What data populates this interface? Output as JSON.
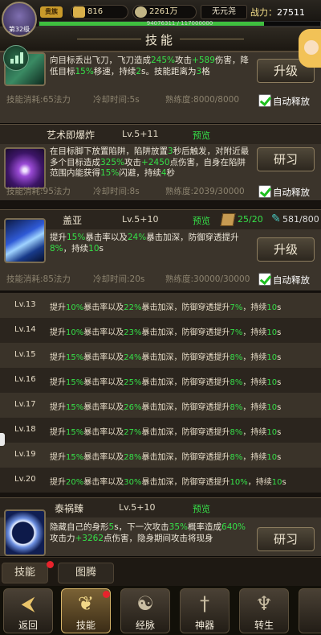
{
  "header": {
    "player_level_label": "第32级",
    "vip_label": "贵族",
    "gold": "816",
    "silver": "2261万",
    "realm": "无元尧",
    "power_label": "战力：",
    "power_value": "27511",
    "exp_text": "94076311 / 117000000",
    "exp_fraction": 0.8
  },
  "page_title": "技能",
  "skills": [
    {
      "id": "flying-knife",
      "desc": "向目标丢出飞刀，飞刀造成245%攻击+589伤害，降低目标15%移速，持续2s。技能距离为3格",
      "cost": "技能消耗:65法力",
      "cooldown": "冷却时间:5s",
      "mastery": "熟练度:8000/8000",
      "button": "升级",
      "auto_label": "自动释放"
    },
    {
      "id": "art-explosion",
      "name": "艺术即爆炸",
      "level": "Lv.5+11",
      "preview": "预览",
      "desc": "在目标脚下放置陷阱，陷阱放置3秒后触发，对附近最多个目标造成325%攻击+2450点伤害，自身在陷阱范围内能获得15%闪避，持续4秒",
      "cost": "技能消耗:95法力",
      "cooldown": "冷却时间:8s",
      "mastery": "熟练度:2039/30000",
      "button": "研习",
      "auto_label": "自动释放"
    },
    {
      "id": "gaia",
      "name": "盖亚",
      "level": "Lv.5+10",
      "preview": "预览",
      "book_count": "25/20",
      "scroll_count": "581/800",
      "desc": "提升15%暴击率以及24%暴击加深，防御穿透提升8%，持续10s",
      "cost": "技能消耗:85法力",
      "cooldown": "冷却时间:20s",
      "mastery": "熟练度:30000/30000",
      "button": "升级",
      "auto_label": "自动释放"
    },
    {
      "id": "tai-huo-zhen",
      "name": "泰祸臻",
      "level": "Lv.5+10",
      "preview": "预览",
      "desc": "隐藏自己的身形5s，下一次攻击35%概率造成640%攻击力+3262点伤害，隐身期间攻击将现身",
      "button": "研习"
    }
  ],
  "levels": [
    {
      "lv": "Lv.13",
      "text": "提升10%暴击率以及22%暴击加深，防御穿透提升7%，持续10s"
    },
    {
      "lv": "Lv.14",
      "text": "提升10%暴击率以及23%暴击加深，防御穿透提升7%，持续10s"
    },
    {
      "lv": "Lv.15",
      "text": "提升15%暴击率以及24%暴击加深，防御穿透提升8%，持续10s"
    },
    {
      "lv": "Lv.16",
      "text": "提升15%暴击率以及25%暴击加深，防御穿透提升8%，持续10s"
    },
    {
      "lv": "Lv.17",
      "text": "提升15%暴击率以及26%暴击加深，防御穿透提升8%，持续10s"
    },
    {
      "lv": "Lv.18",
      "text": "提升15%暴击率以及27%暴击加深，防御穿透提升8%，持续10s"
    },
    {
      "lv": "Lv.19",
      "text": "提升15%暴击率以及28%暴击加深，防御穿透提升8%，持续10s"
    },
    {
      "lv": "Lv.20",
      "text": "提升20%暴击率以及30%暴击加深，防御穿透提升10%，持续10s"
    }
  ],
  "tabs": [
    "技能",
    "图腾"
  ],
  "nav": [
    "返回",
    "技能",
    "经脉",
    "神器",
    "转生"
  ]
}
